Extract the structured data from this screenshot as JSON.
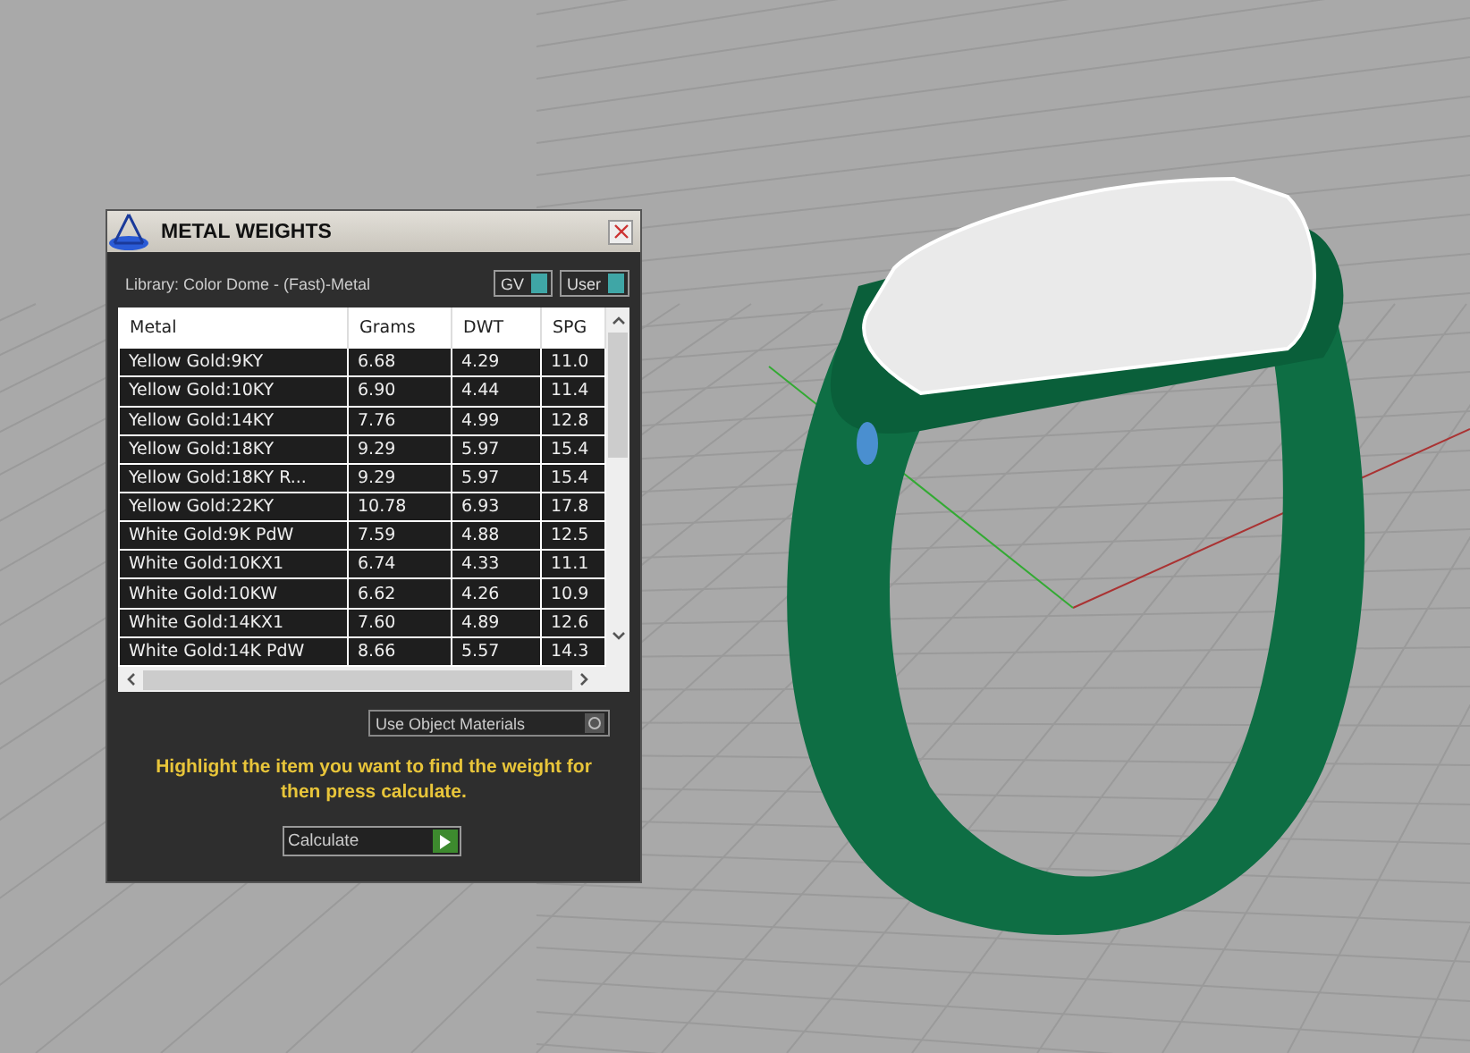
{
  "panel": {
    "title": "METAL WEIGHTS",
    "library": "Library: Color Dome - (Fast)-Metal",
    "toggles": [
      "GV",
      "User"
    ],
    "table": {
      "columns": [
        "Metal",
        "Grams",
        "DWT",
        "SPG"
      ],
      "rows": [
        [
          "Yellow Gold:9KY",
          "6.68",
          "4.29",
          "11.0"
        ],
        [
          "Yellow Gold:10KY",
          "6.90",
          "4.44",
          "11.4"
        ],
        [
          "Yellow Gold:14KY",
          "7.76",
          "4.99",
          "12.8"
        ],
        [
          "Yellow Gold:18KY",
          "9.29",
          "5.97",
          "15.4"
        ],
        [
          "Yellow Gold:18KY R...",
          "9.29",
          "5.97",
          "15.4"
        ],
        [
          "Yellow Gold:22KY",
          "10.78",
          "6.93",
          "17.8"
        ],
        [
          "White Gold:9K PdW",
          "7.59",
          "4.88",
          "12.5"
        ],
        [
          "White Gold:10KX1",
          "6.74",
          "4.33",
          "11.1"
        ],
        [
          "White Gold:10KW",
          "6.62",
          "4.26",
          "10.9"
        ],
        [
          "White Gold:14KX1",
          "7.60",
          "4.89",
          "12.6"
        ],
        [
          "White Gold:14K PdW",
          "8.66",
          "5.57",
          "14.3"
        ]
      ]
    },
    "use_object_materials": "Use Object Materials",
    "hint": "Highlight the item you want to find the weight for then press calculate.",
    "calculate": "Calculate"
  }
}
